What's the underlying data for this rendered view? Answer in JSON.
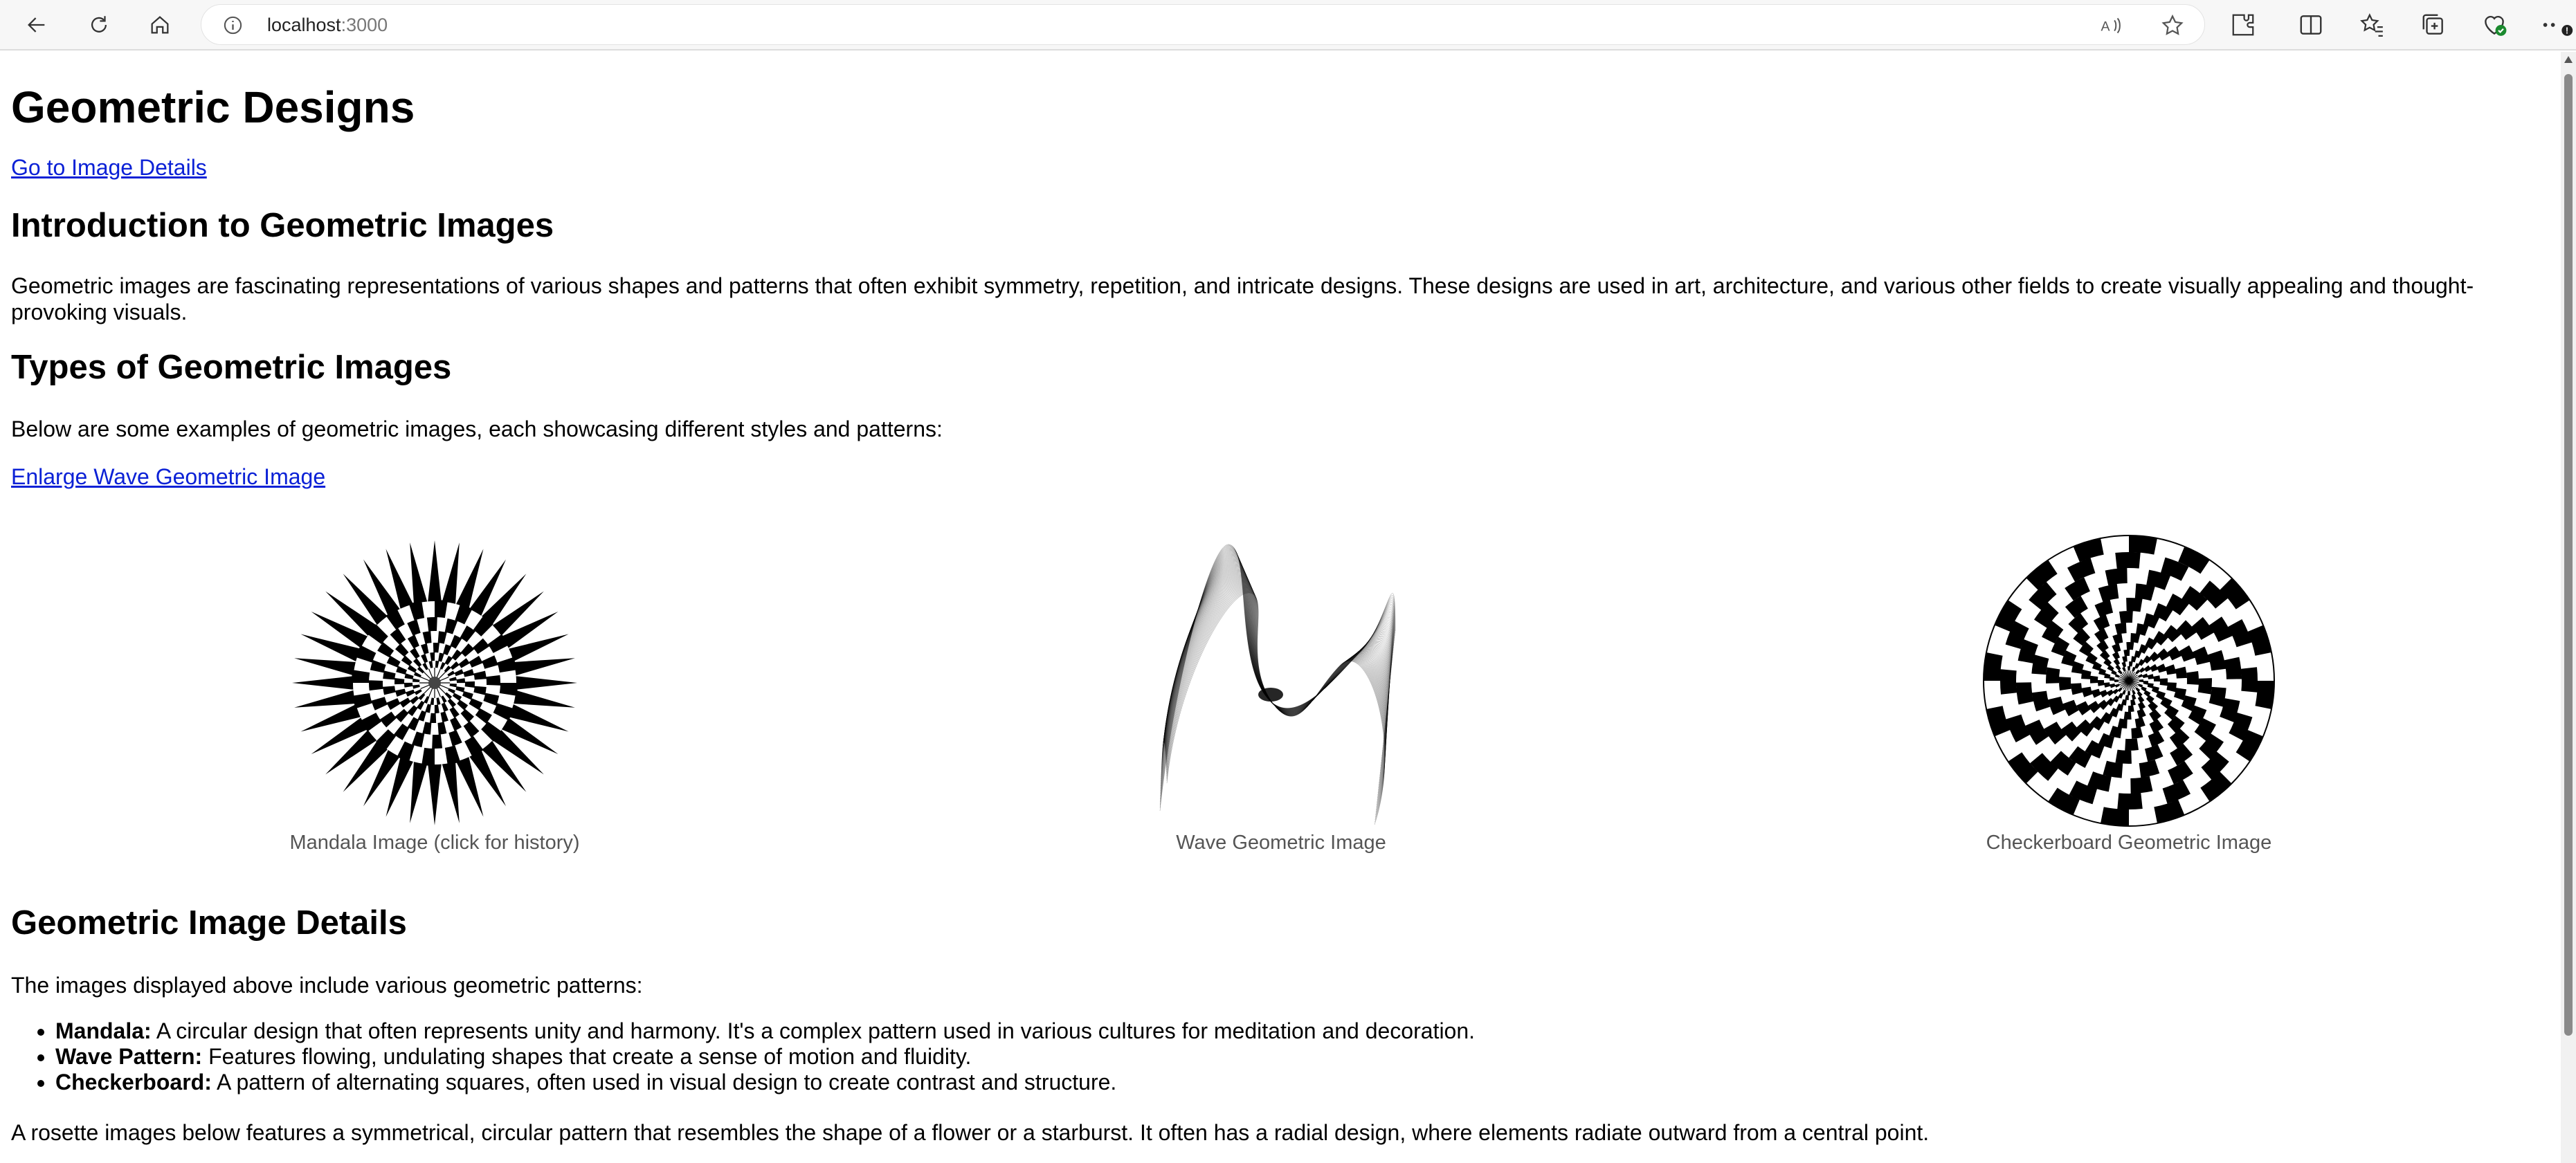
{
  "browser": {
    "url_host": "localhost",
    "url_port": ":3000"
  },
  "page": {
    "title": "Geometric Designs",
    "details_link": "Go to Image Details",
    "intro_heading": "Introduction to Geometric Images",
    "intro_text": "Geometric images are fascinating representations of various shapes and patterns that often exhibit symmetry, repetition, and intricate designs. These designs are used in art, architecture, and various other fields to create visually appealing and thought-provoking visuals.",
    "types_heading": "Types of Geometric Images",
    "types_text": "Below are some examples of geometric images, each showcasing different styles and patterns:",
    "enlarge_link": "Enlarge Wave Geometric Image",
    "figures": [
      {
        "caption": "Mandala Image (click for history)"
      },
      {
        "caption": "Wave Geometric Image"
      },
      {
        "caption": "Checkerboard Geometric Image"
      }
    ],
    "details_heading": "Geometric Image Details",
    "details_text": "The images displayed above include various geometric patterns:",
    "list": [
      {
        "term": "Mandala:",
        "desc": " A circular design that often represents unity and harmony. It's a complex pattern used in various cultures for meditation and decoration."
      },
      {
        "term": "Wave Pattern:",
        "desc": " Features flowing, undulating shapes that create a sense of motion and fluidity."
      },
      {
        "term": "Checkerboard:",
        "desc": " A pattern of alternating squares, often used in visual design to create contrast and structure."
      }
    ],
    "rosette_text": "A rosette images below features a symmetrical, circular pattern that resembles the shape of a flower or a starburst. It often has a radial design, where elements radiate outward from a central point."
  }
}
